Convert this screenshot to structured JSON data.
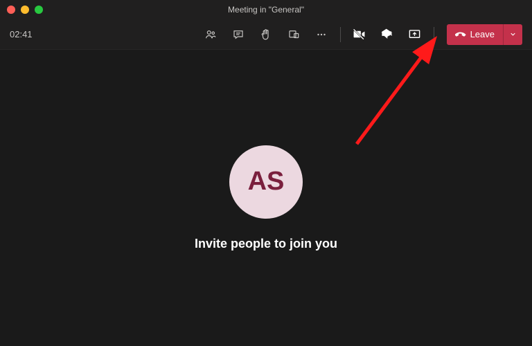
{
  "window": {
    "title": "Meeting in \"General\""
  },
  "toolbar": {
    "timer": "02:41",
    "leave_label": "Leave"
  },
  "main": {
    "avatar_initials": "AS",
    "invite_text": "Invite people to join you"
  },
  "colors": {
    "leave_button": "#c4314b",
    "avatar_bg": "#ecd8e0",
    "avatar_fg": "#7a1f3d"
  }
}
